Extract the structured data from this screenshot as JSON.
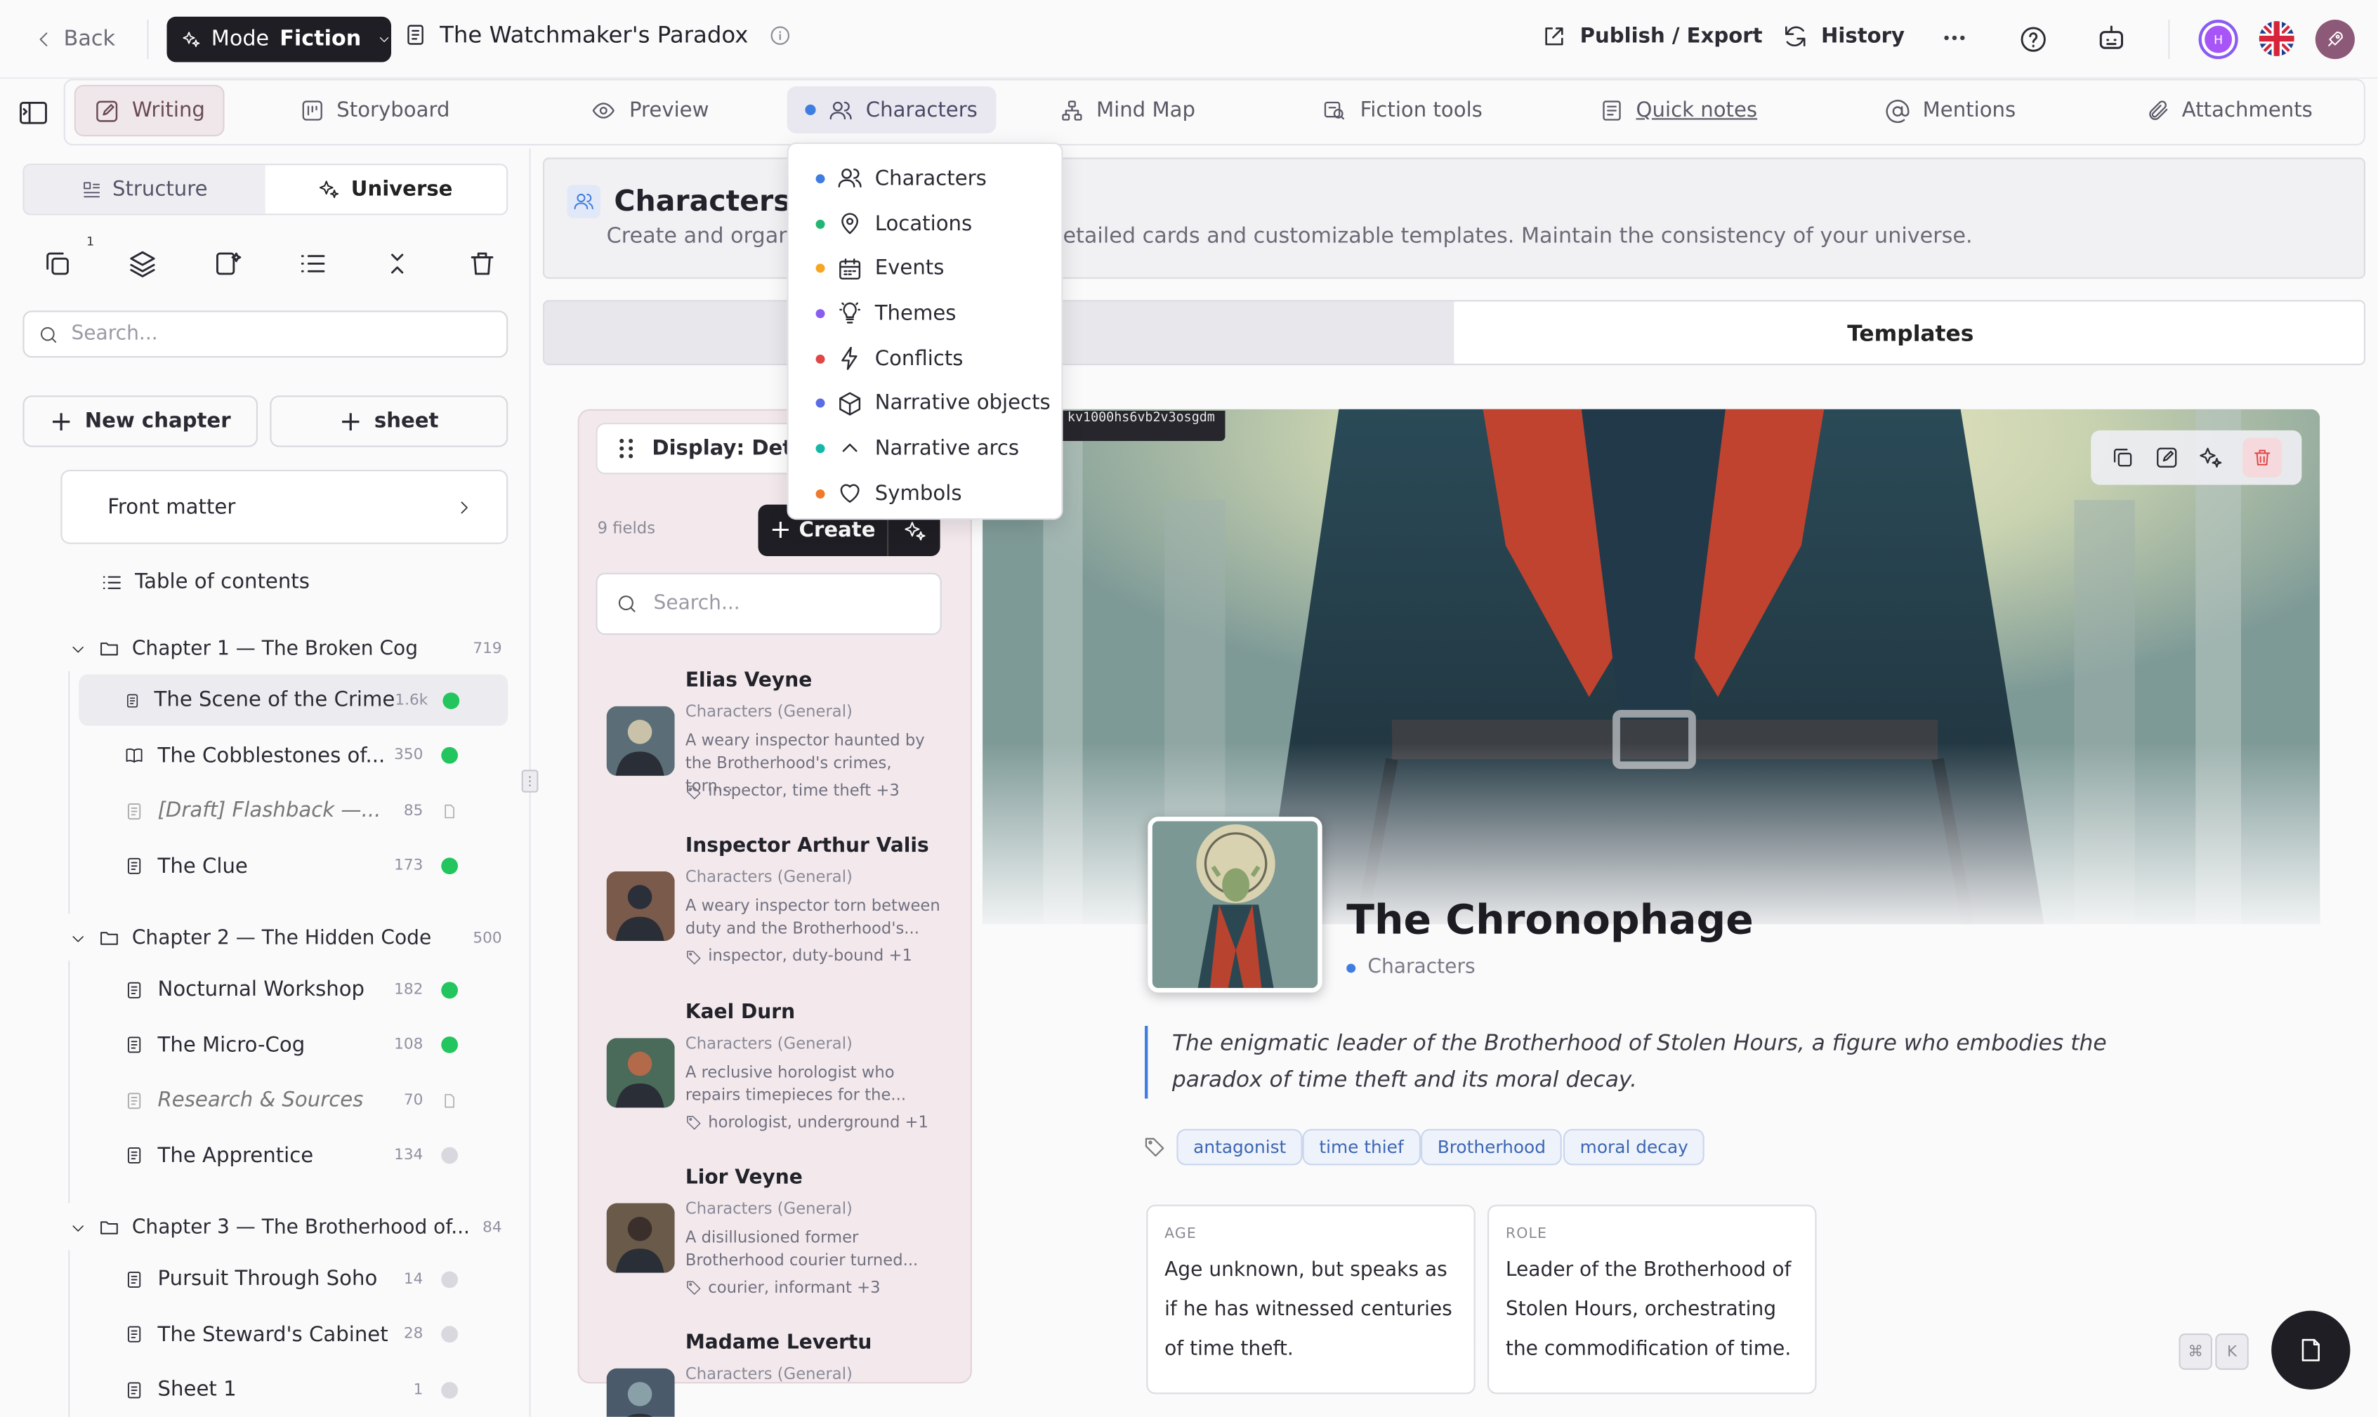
{
  "topbar": {
    "back": "Back",
    "mode_label": "Mode",
    "mode_value": "Fiction",
    "doc_title": "The Watchmaker's Paradox",
    "publish": "Publish / Export",
    "history": "History",
    "avatar_initial": "H"
  },
  "tabs": {
    "writing": "Writing",
    "storyboard": "Storyboard",
    "preview": "Preview",
    "characters": "Characters",
    "mindmap": "Mind Map",
    "fiction_tools": "Fiction tools",
    "quick_notes": "Quick notes",
    "mentions": "Mentions",
    "attachments": "Attachments"
  },
  "sidebar": {
    "seg_structure": "Structure",
    "seg_universe": "Universe",
    "badge": "1",
    "search_placeholder": "Search...",
    "new_chapter": "New chapter",
    "new_sheet": "sheet",
    "front_matter": "Front matter",
    "toc": "Table of contents",
    "chapters": [
      {
        "title": "Chapter 1 — The Broken Cog",
        "count": "719",
        "items": [
          {
            "title": "The Scene of the Crime",
            "count": "1.6k",
            "status": "done"
          },
          {
            "title": "The Cobblestones of...",
            "count": "350",
            "status": "done"
          },
          {
            "title": "[Draft] Flashback —...",
            "count": "85",
            "status": "draft"
          },
          {
            "title": "The Clue",
            "count": "173",
            "status": "done"
          }
        ]
      },
      {
        "title": "Chapter 2 — The Hidden Code",
        "count": "500",
        "items": [
          {
            "title": "Nocturnal Workshop",
            "count": "182",
            "status": "done"
          },
          {
            "title": "The Micro-Cog",
            "count": "108",
            "status": "done"
          },
          {
            "title": "Research & Sources",
            "count": "70",
            "status": "draft"
          },
          {
            "title": "The Apprentice",
            "count": "134",
            "status": "todo"
          }
        ]
      },
      {
        "title": "Chapter 3 — The Brotherhood of...",
        "count": "84",
        "items": [
          {
            "title": "Pursuit Through Soho",
            "count": "14",
            "status": "todo"
          },
          {
            "title": "The Steward's Cabinet",
            "count": "28",
            "status": "todo"
          },
          {
            "title": "Sheet 1",
            "count": "1",
            "status": "todo"
          }
        ]
      }
    ]
  },
  "header": {
    "title": "Characters",
    "desc_left": "Create and organ",
    "desc_right": "etailed cards and customizable templates. Maintain the consistency of your universe."
  },
  "subtabs": {
    "templates": "Templates"
  },
  "list": {
    "display": "Display: Deta",
    "fields_count": "9 fields",
    "create": "Create",
    "search_placeholder": "Search...",
    "cards": [
      {
        "name": "Elias Veyne",
        "type": "Characters (General)",
        "desc": "A weary inspector haunted by the Brotherhood's crimes, torn...",
        "tags": "inspector, time theft +3"
      },
      {
        "name": "Inspector Arthur Valis",
        "type": "Characters (General)",
        "desc": "A weary inspector torn between duty and the Brotherhood's...",
        "tags": "inspector, duty-bound +1"
      },
      {
        "name": "Kael Durn",
        "type": "Characters (General)",
        "desc": "A reclusive horologist who repairs timepieces for the...",
        "tags": "horologist, underground +1"
      },
      {
        "name": "Lior Veyne",
        "type": "Characters (General)",
        "desc": "A disillusioned former Brotherhood courier turned...",
        "tags": "courier, informant +3"
      },
      {
        "name": "Madame Levertu",
        "type": "Characters (General)",
        "desc": "",
        "tags": ""
      }
    ]
  },
  "detail": {
    "id": "kv1000hs6vb2v3osgdm",
    "name": "The Chronophage",
    "category": "Characters",
    "quote": "The enigmatic leader of the Brotherhood of Stolen Hours, a figure who embodies the paradox of time theft and its moral decay.",
    "tags": [
      "antagonist",
      "time thief",
      "Brotherhood",
      "moral decay"
    ],
    "fields": [
      {
        "label": "AGE",
        "value": "Age unknown, but speaks as if he has witnessed centuries of time theft."
      },
      {
        "label": "ROLE",
        "value": "Leader of the Brotherhood of Stolen Hours, orchestrating the commodification of time."
      }
    ],
    "kbd": [
      "⌘",
      "K"
    ]
  },
  "dropdown": {
    "items": [
      {
        "label": "Characters",
        "color": "#3f7de0",
        "icon": "users-icon"
      },
      {
        "label": "Locations",
        "color": "#22b573",
        "icon": "map-pin-icon"
      },
      {
        "label": "Events",
        "color": "#f5a623",
        "icon": "calendar-icon"
      },
      {
        "label": "Themes",
        "color": "#8a5cf0",
        "icon": "lightbulb-icon"
      },
      {
        "label": "Conflicts",
        "color": "#e04646",
        "icon": "zap-icon"
      },
      {
        "label": "Narrative objects",
        "color": "#5a6de6",
        "icon": "box-icon"
      },
      {
        "label": "Narrative arcs",
        "color": "#15b8a6",
        "icon": "chevron-up-icon"
      },
      {
        "label": "Symbols",
        "color": "#f07a2b",
        "icon": "heart-icon"
      }
    ]
  },
  "colors": {
    "accent": "#3f7de0",
    "done": "#22c55e",
    "danger": "#e04646",
    "dark": "#1e1e24"
  }
}
